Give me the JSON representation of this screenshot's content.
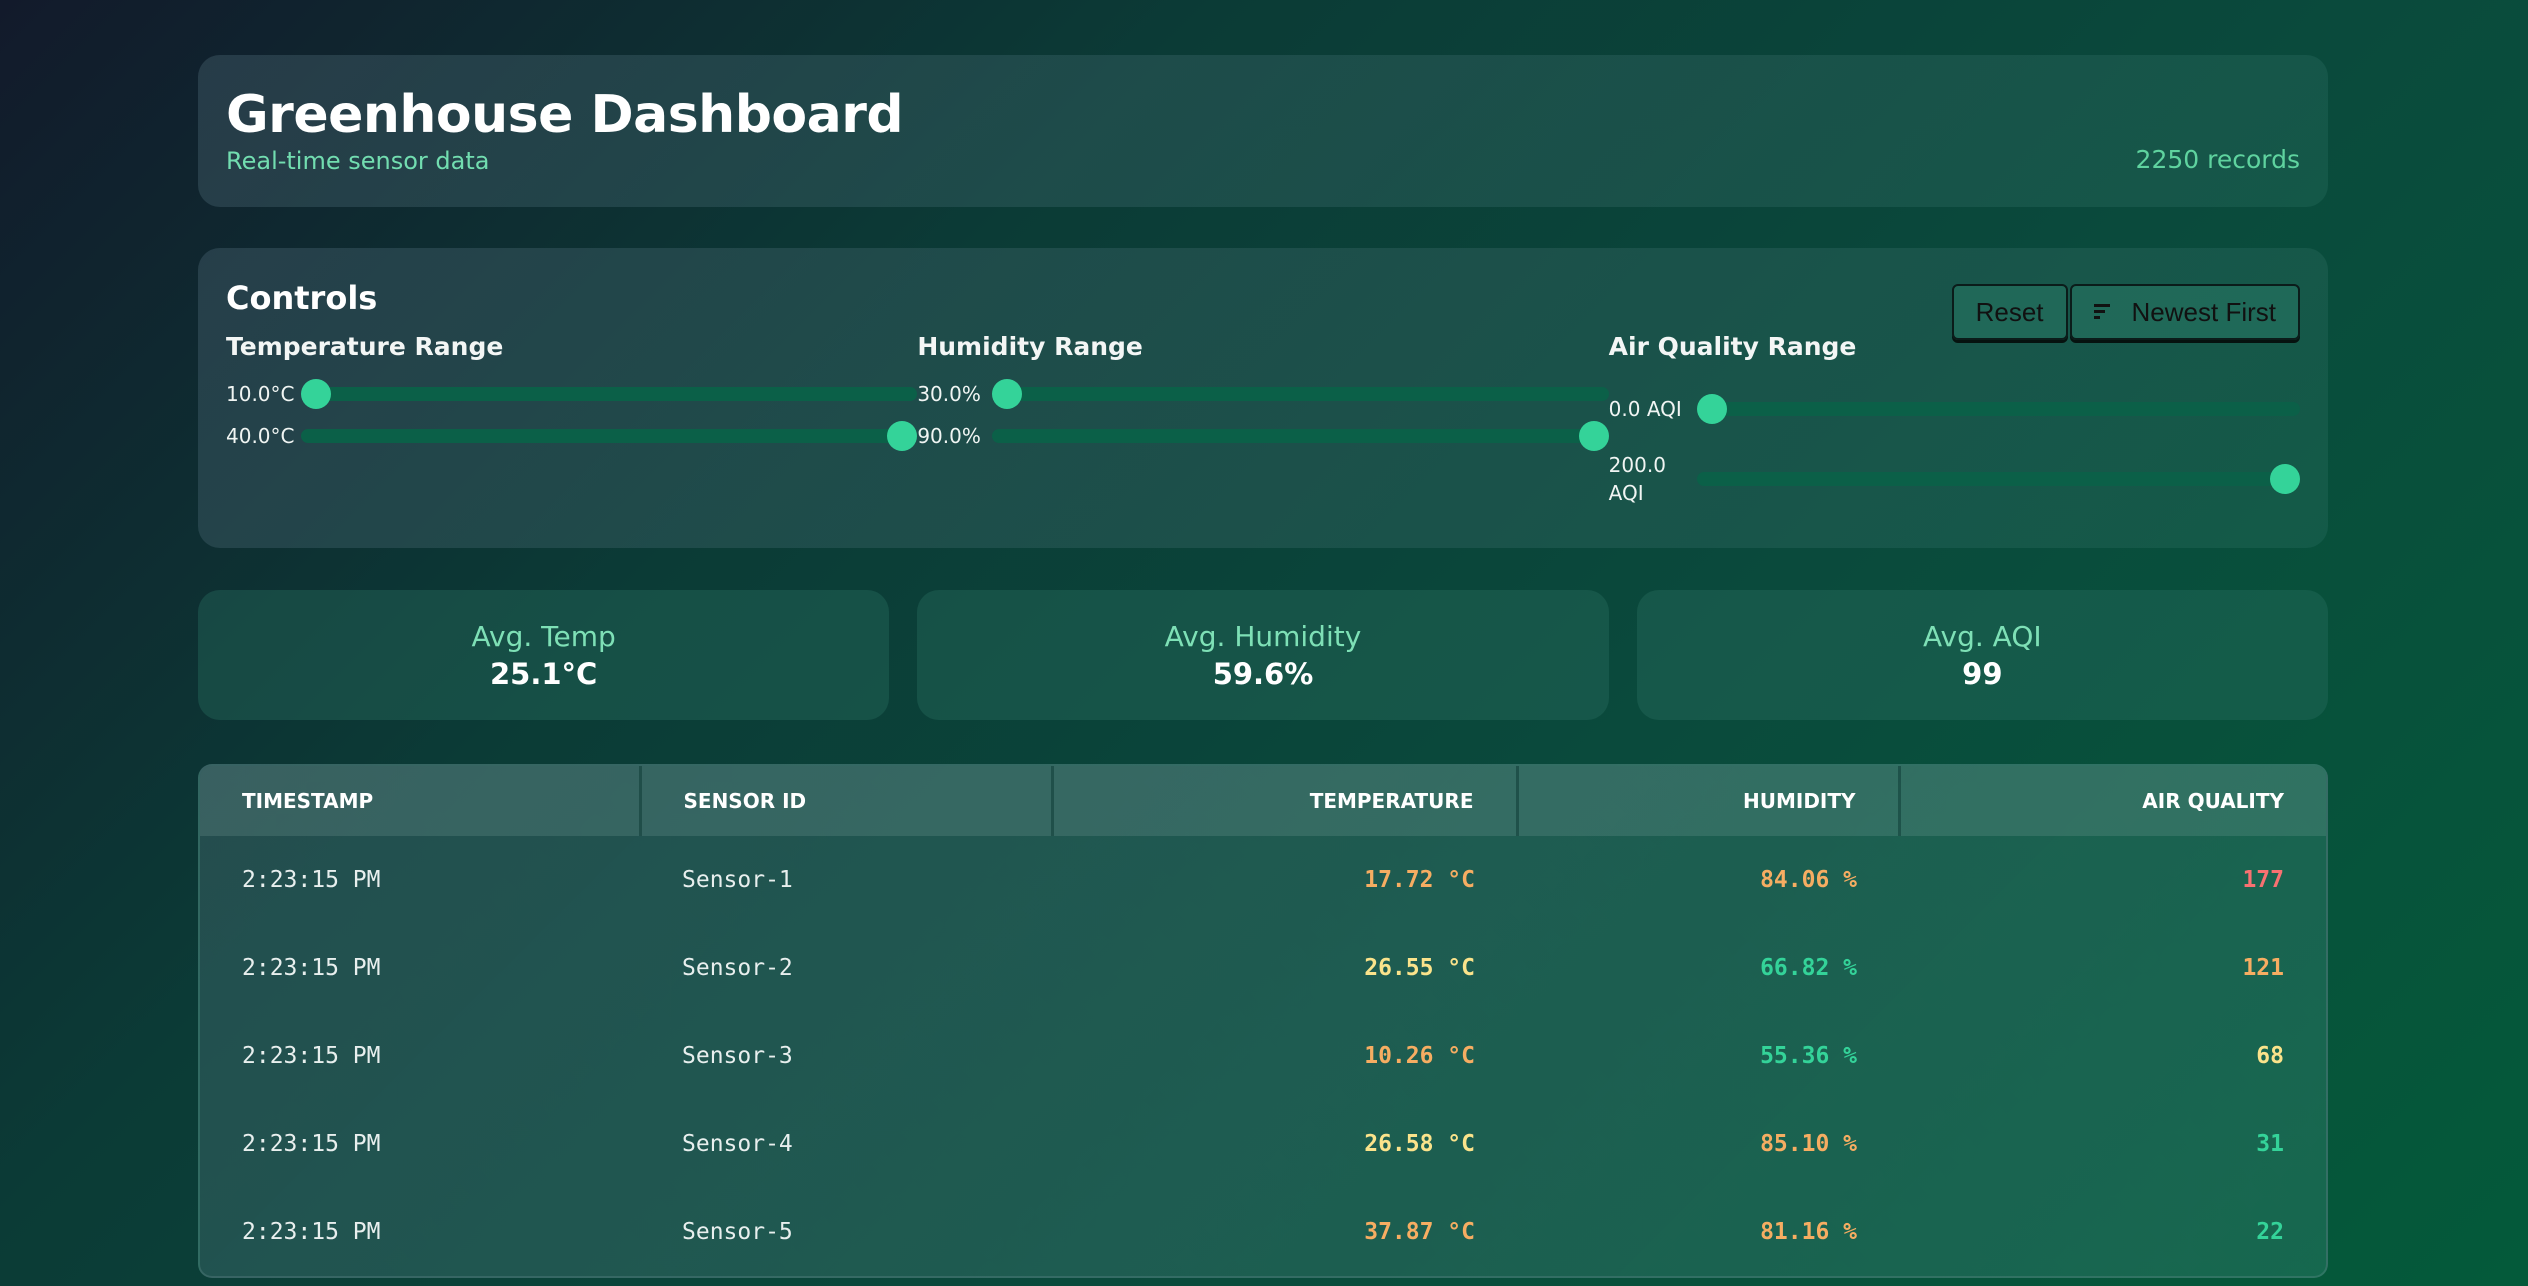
{
  "header": {
    "title": "Greenhouse Dashboard",
    "subtitle": "Real-time sensor data",
    "records": "2250 records"
  },
  "controls": {
    "title": "Controls",
    "reset_label": "Reset",
    "sort_label": "Newest First",
    "sort_icon": "sort-icon",
    "temperature": {
      "label": "Temperature Range",
      "min_label": "10.0°C",
      "max_label": "40.0°C",
      "min_fraction": 0.0,
      "max_fraction": 1.0
    },
    "humidity": {
      "label": "Humidity Range",
      "min_label": "30.0%",
      "max_label": "90.0%",
      "min_fraction": 0.0,
      "max_fraction": 1.0
    },
    "air_quality": {
      "label": "Air Quality Range",
      "min_label": "0.0 AQI",
      "max_label": "200.0 AQI",
      "min_fraction": 0.0,
      "max_fraction": 1.0
    }
  },
  "stats": {
    "temp": {
      "label": "Avg. Temp",
      "value": "25.1°C"
    },
    "humidity": {
      "label": "Avg. Humidity",
      "value": "59.6%"
    },
    "aqi": {
      "label": "Avg. AQI",
      "value": "99"
    }
  },
  "table": {
    "headers": [
      "Timestamp",
      "Sensor ID",
      "Temperature",
      "Humidity",
      "Air Quality"
    ],
    "rows": [
      {
        "timestamp": "2:23:15 PM",
        "sensor": "Sensor-1",
        "temperature": "17.72 °C",
        "humidity": "84.06 %",
        "air_quality": "177",
        "temp_color": "orange",
        "hum_color": "orange",
        "aq_color": "red"
      },
      {
        "timestamp": "2:23:15 PM",
        "sensor": "Sensor-2",
        "temperature": "26.55 °C",
        "humidity": "66.82 %",
        "air_quality": "121",
        "temp_color": "yellow",
        "hum_color": "green",
        "aq_color": "orange"
      },
      {
        "timestamp": "2:23:15 PM",
        "sensor": "Sensor-3",
        "temperature": "10.26 °C",
        "humidity": "55.36 %",
        "air_quality": "68",
        "temp_color": "orange",
        "hum_color": "green",
        "aq_color": "yellow"
      },
      {
        "timestamp": "2:23:15 PM",
        "sensor": "Sensor-4",
        "temperature": "26.58 °C",
        "humidity": "85.10 %",
        "air_quality": "31",
        "temp_color": "yellow",
        "hum_color": "orange",
        "aq_color": "green"
      },
      {
        "timestamp": "2:23:15 PM",
        "sensor": "Sensor-5",
        "temperature": "37.87 °C",
        "humidity": "81.16 %",
        "air_quality": "22",
        "temp_color": "orange",
        "hum_color": "orange",
        "aq_color": "green"
      }
    ]
  },
  "colors": {
    "accent": "#34d399",
    "orange": "#f6ad62",
    "yellow": "#fbe38b",
    "green": "#34d399",
    "red": "#f87171"
  }
}
